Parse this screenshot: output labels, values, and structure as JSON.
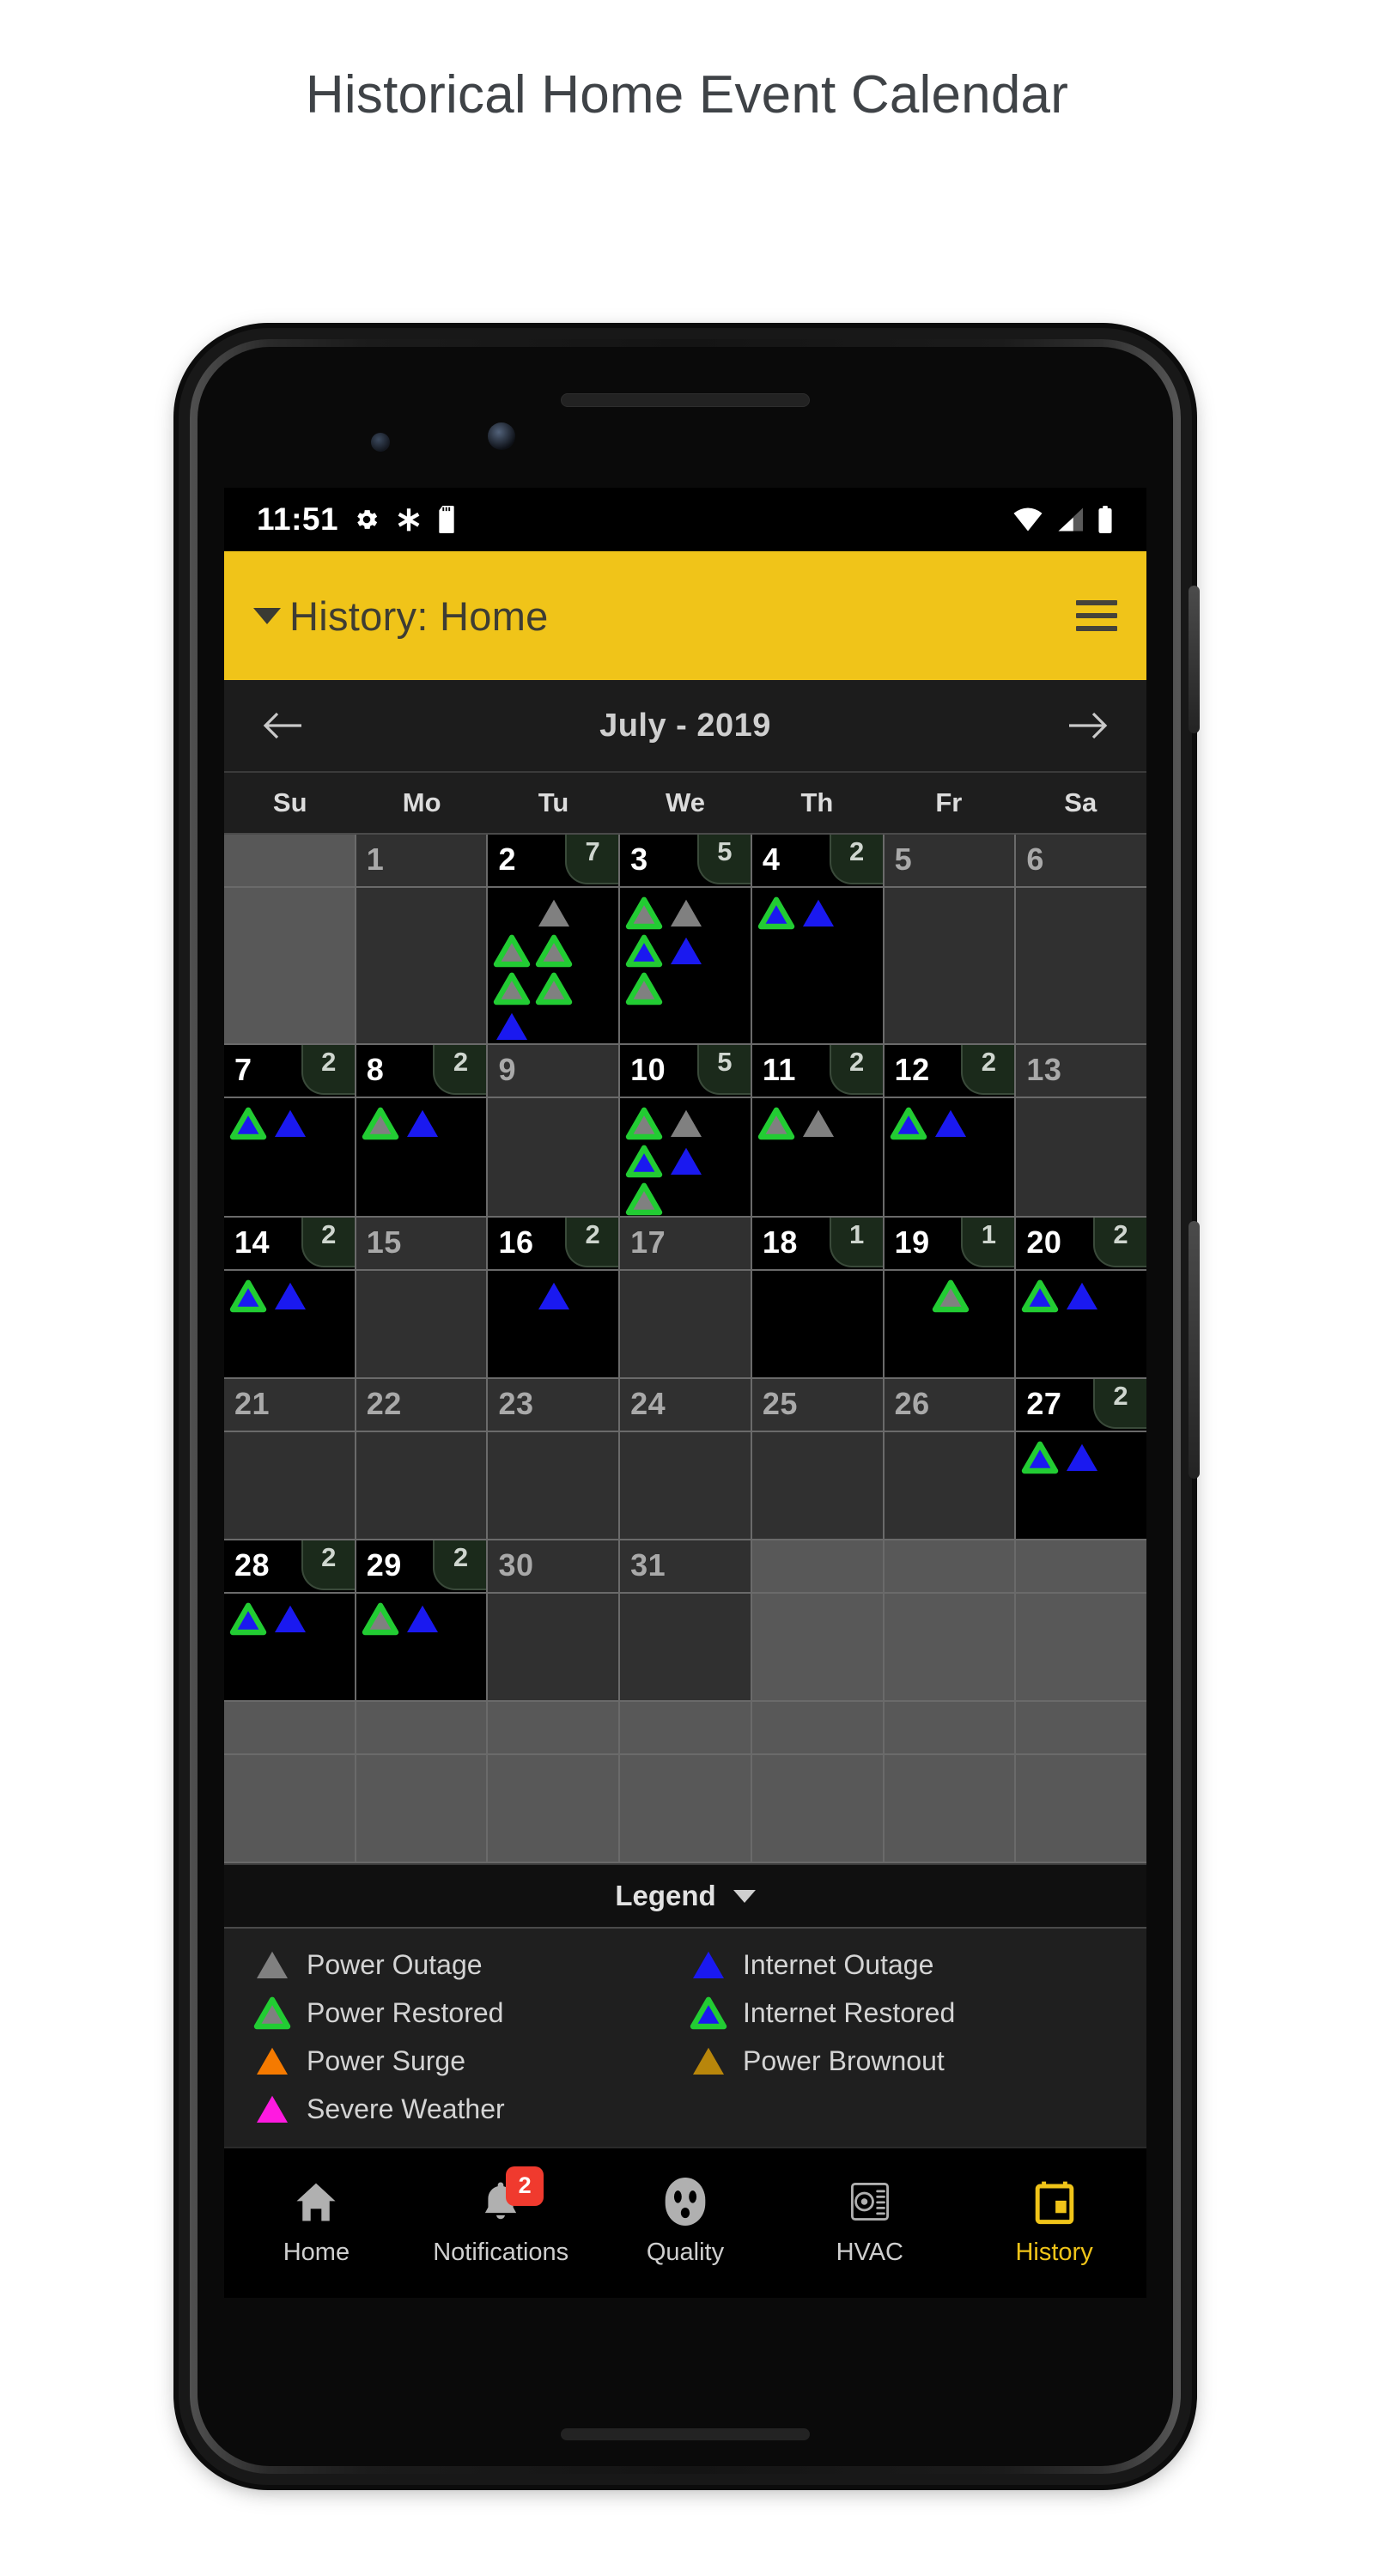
{
  "page": {
    "title": "Historical Home Event Calendar"
  },
  "status_bar": {
    "time": "11:51",
    "left_icons": [
      "gear-icon",
      "asterisk-icon",
      "sd-card-icon"
    ],
    "right_icons": [
      "wifi-icon",
      "cell-signal-icon",
      "battery-icon"
    ]
  },
  "app_bar": {
    "title": "History: Home",
    "caret": "▼",
    "menu_icon": "hamburger-menu-icon",
    "background": "#f0c419",
    "text_color": "#3e3d33"
  },
  "month_nav": {
    "prev_label": "←",
    "next_label": "→",
    "month_label": "July - 2019"
  },
  "weekdays": [
    "Su",
    "Mo",
    "Tu",
    "We",
    "Th",
    "Fr",
    "Sa"
  ],
  "legend": {
    "title": "Legend",
    "caret": "▼",
    "items": [
      {
        "label": "Power Outage",
        "type": "power_outage",
        "fill": "#808080",
        "stroke": "none"
      },
      {
        "label": "Internet Outage",
        "type": "internet_outage",
        "fill": "#1a19f0",
        "stroke": "none"
      },
      {
        "label": "Power Restored",
        "type": "power_restored",
        "fill": "#808080",
        "stroke": "#22cc33"
      },
      {
        "label": "Internet Restored",
        "type": "internet_restored",
        "fill": "#1a19f0",
        "stroke": "#22cc33"
      },
      {
        "label": "Power Surge",
        "type": "power_surge",
        "fill": "#f57a00",
        "stroke": "none"
      },
      {
        "label": "Power Brownout",
        "type": "power_brownout",
        "fill": "#b8860b",
        "stroke": "none"
      },
      {
        "label": "Severe Weather",
        "type": "severe_weather",
        "fill": "#ff1ae0",
        "stroke": "none"
      }
    ]
  },
  "bottom_nav": {
    "items": [
      {
        "label": "Home",
        "icon": "home-icon",
        "active": false,
        "badge": null
      },
      {
        "label": "Notifications",
        "icon": "bell-icon",
        "active": false,
        "badge": "2"
      },
      {
        "label": "Quality",
        "icon": "power-outlet-icon",
        "active": false,
        "badge": null
      },
      {
        "label": "HVAC",
        "icon": "hvac-vent-icon",
        "active": false,
        "badge": null
      },
      {
        "label": "History",
        "icon": "calendar-icon",
        "active": true,
        "badge": null
      }
    ],
    "active_color": "#f0c419"
  },
  "system_nav": {
    "buttons": [
      "back-button",
      "home-button",
      "recents-button"
    ]
  },
  "calendar": {
    "month": "July",
    "year": "2019",
    "weeks": [
      [
        {
          "day": "",
          "state": "blank",
          "badge": null,
          "markers": []
        },
        {
          "day": "1",
          "state": "muted",
          "badge": null,
          "markers": []
        },
        {
          "day": "2",
          "state": "active",
          "badge": "7",
          "markers": [
            "none",
            "power_outage",
            "power_restored",
            "power_restored",
            "power_restored",
            "power_restored",
            "internet_outage"
          ]
        },
        {
          "day": "3",
          "state": "active",
          "badge": "5",
          "markers": [
            "power_restored",
            "power_outage",
            "internet_restored",
            "internet_outage",
            "power_restored"
          ]
        },
        {
          "day": "4",
          "state": "active",
          "badge": "2",
          "markers": [
            "internet_restored",
            "internet_outage"
          ]
        },
        {
          "day": "5",
          "state": "muted",
          "badge": null,
          "markers": []
        },
        {
          "day": "6",
          "state": "muted",
          "badge": null,
          "markers": []
        }
      ],
      [
        {
          "day": "7",
          "state": "active",
          "badge": "2",
          "markers": [
            "internet_restored",
            "internet_outage"
          ]
        },
        {
          "day": "8",
          "state": "active",
          "badge": "2",
          "markers": [
            "power_restored",
            "internet_outage"
          ]
        },
        {
          "day": "9",
          "state": "muted",
          "badge": null,
          "markers": []
        },
        {
          "day": "10",
          "state": "active",
          "badge": "5",
          "markers": [
            "power_restored",
            "power_outage",
            "internet_restored",
            "internet_outage",
            "power_restored"
          ]
        },
        {
          "day": "11",
          "state": "active",
          "badge": "2",
          "markers": [
            "power_restored",
            "power_outage"
          ]
        },
        {
          "day": "12",
          "state": "active",
          "badge": "2",
          "markers": [
            "internet_restored",
            "internet_outage"
          ]
        },
        {
          "day": "13",
          "state": "muted",
          "badge": null,
          "markers": []
        }
      ],
      [
        {
          "day": "14",
          "state": "active",
          "badge": "2",
          "markers": [
            "internet_restored",
            "internet_outage"
          ]
        },
        {
          "day": "15",
          "state": "muted",
          "badge": null,
          "markers": []
        },
        {
          "day": "16",
          "state": "active",
          "badge": "2",
          "markers": [
            "none",
            "internet_outage"
          ]
        },
        {
          "day": "17",
          "state": "muted",
          "badge": null,
          "markers": []
        },
        {
          "day": "18",
          "state": "active",
          "badge": "1",
          "markers": []
        },
        {
          "day": "19",
          "state": "active",
          "badge": "1",
          "markers": [
            "none",
            "power_restored"
          ]
        },
        {
          "day": "20",
          "state": "active",
          "badge": "2",
          "markers": [
            "internet_restored",
            "internet_outage"
          ]
        }
      ],
      [
        {
          "day": "21",
          "state": "muted",
          "badge": null,
          "markers": []
        },
        {
          "day": "22",
          "state": "muted",
          "badge": null,
          "markers": []
        },
        {
          "day": "23",
          "state": "muted",
          "badge": null,
          "markers": []
        },
        {
          "day": "24",
          "state": "muted",
          "badge": null,
          "markers": []
        },
        {
          "day": "25",
          "state": "muted",
          "badge": null,
          "markers": []
        },
        {
          "day": "26",
          "state": "muted",
          "badge": null,
          "markers": []
        },
        {
          "day": "27",
          "state": "active",
          "badge": "2",
          "markers": [
            "internet_restored",
            "internet_outage"
          ]
        }
      ],
      [
        {
          "day": "28",
          "state": "active",
          "badge": "2",
          "markers": [
            "internet_restored",
            "internet_outage"
          ]
        },
        {
          "day": "29",
          "state": "active",
          "badge": "2",
          "markers": [
            "power_restored",
            "internet_outage"
          ]
        },
        {
          "day": "30",
          "state": "muted",
          "badge": null,
          "markers": []
        },
        {
          "day": "31",
          "state": "muted",
          "badge": null,
          "markers": []
        },
        {
          "day": "",
          "state": "blank",
          "badge": null,
          "markers": []
        },
        {
          "day": "",
          "state": "blank",
          "badge": null,
          "markers": []
        },
        {
          "day": "",
          "state": "blank",
          "badge": null,
          "markers": []
        }
      ],
      [
        {
          "day": "",
          "state": "blank",
          "badge": null,
          "markers": []
        },
        {
          "day": "",
          "state": "blank",
          "badge": null,
          "markers": []
        },
        {
          "day": "",
          "state": "blank",
          "badge": null,
          "markers": []
        },
        {
          "day": "",
          "state": "blank",
          "badge": null,
          "markers": []
        },
        {
          "day": "",
          "state": "blank",
          "badge": null,
          "markers": []
        },
        {
          "day": "",
          "state": "blank",
          "badge": null,
          "markers": []
        },
        {
          "day": "",
          "state": "blank",
          "badge": null,
          "markers": []
        }
      ]
    ]
  },
  "marker_styles": {
    "power_outage": {
      "fill": "#808080",
      "stroke": "none"
    },
    "power_restored": {
      "fill": "#808080",
      "stroke": "#22cc33"
    },
    "internet_outage": {
      "fill": "#1a19f0",
      "stroke": "none"
    },
    "internet_restored": {
      "fill": "#1a19f0",
      "stroke": "#22cc33"
    },
    "power_surge": {
      "fill": "#f57a00",
      "stroke": "none"
    },
    "power_brownout": {
      "fill": "#b8860b",
      "stroke": "none"
    },
    "severe_weather": {
      "fill": "#ff1ae0",
      "stroke": "none"
    },
    "none": {
      "fill": "none",
      "stroke": "none"
    }
  }
}
